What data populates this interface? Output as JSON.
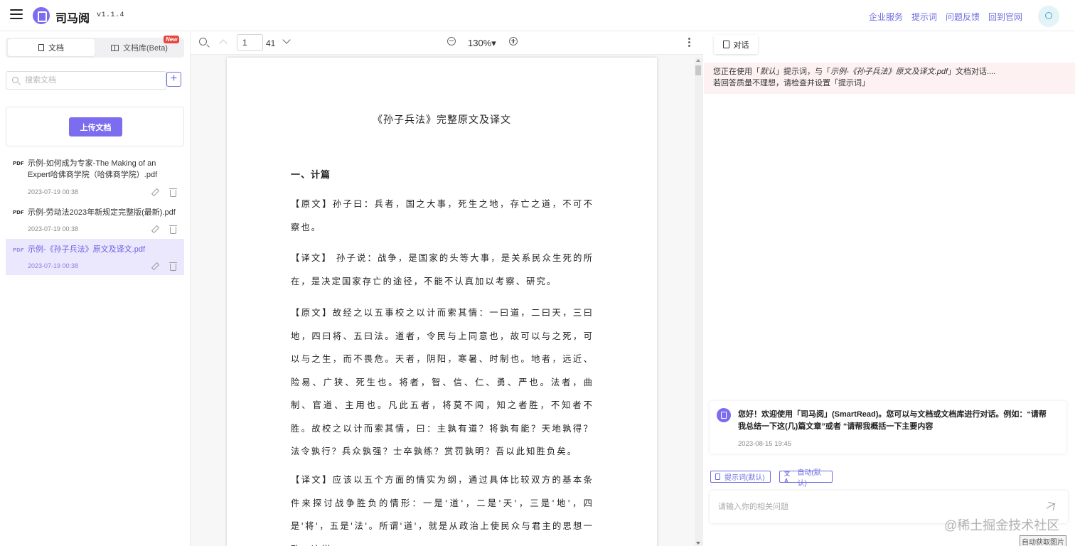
{
  "header": {
    "app_name": "司马阅",
    "version": "v1.1.4",
    "links": [
      "企业服务",
      "提示词",
      "问题反馈",
      "回到官网"
    ]
  },
  "sidebar": {
    "tabs": {
      "docs": "文档",
      "library": "文档库(Beta)",
      "new_badge": "New"
    },
    "search_placeholder": "搜索文档",
    "add_label": "+",
    "upload_label": "上传文档",
    "documents": [
      {
        "tag": "PDF",
        "title": "示例-如何成为专家-The Making of an Expert哈佛商学院（哈佛商学院）.pdf",
        "date": "2023-07-19 00:38"
      },
      {
        "tag": "PDF",
        "title": "示例-劳动法2023年新规定完整版(最新).pdf",
        "date": "2023-07-19 00:38"
      },
      {
        "tag": "PDF",
        "title": "示例-《孙子兵法》原文及译文.pdf",
        "date": "2023-07-19 00:38",
        "active": true
      }
    ]
  },
  "viewer": {
    "page_current": "1",
    "page_total": "41",
    "zoom": "130%▾",
    "doc_title": "《孙子兵法》完整原文及译文",
    "section": "一、计篇",
    "paragraphs": [
      "【原文】孙子曰：兵者，国之大事，死生之地，存亡之道，不可不察也。",
      "【译文】 孙子说：战争，是国家的头等大事，是关系民众生死的所在，是决定国家存亡的途径，不能不认真加以考察、研究。",
      "【原文】故经之以五事校之以计而索其情：一曰道，二曰天，三曰地，四曰将、五曰法。道者，令民与上同意也，故可以与之死，可以与之生，而不畏危。天者，阴阳，寒暑、时制也。地者，远近、险易、广狭、死生也。将者，智、信、仁、勇、严也。法者，曲制、官道、主用也。凡此五者，将莫不闻，知之者胜，不知者不胜。故校之以计而索其情，曰：主孰有道？将孰有能？天地孰得？法令孰行？兵众孰强？士卒孰练？赏罚孰明？吾以此知胜负矣。",
      "【译文】应该以五个方面的情实为纲，通过具体比较双方的基本条件来探讨战争胜负的情形：一是'道'，二是'天'，三是'地'，四是'将'，五是'法'。所谓'道'，就是从政治上使民众与君主的思想一致，这样，"
    ]
  },
  "chat": {
    "tab_label": "对话",
    "notice_prefix": "您正在使用「",
    "notice_prompt": "默认",
    "notice_mid": "」提示词，与「",
    "notice_doc": "示例-《孙子兵法》原文及译文.pdf",
    "notice_suffix": "」文档对话....",
    "notice_line2": "若回答质量不理想，请检查并设置「提示词」",
    "message": "您好！欢迎使用「司马阅」(SmartRead)。您可以与文档或文档库进行对话。例如：“请帮我总结一下这(几)篇文章”或者 “请帮我概括一下主要内容",
    "message_time": "2023-08-15 19:45",
    "pill_prompt": "提示词(默认)",
    "pill_auto": "自动(默认)",
    "input_placeholder": "请输入你的相关问题"
  },
  "overlay": {
    "watermark": "@稀土掘金技术社区",
    "label": "自动获取图片"
  },
  "colors": {
    "accent": "#7b6cf0",
    "link": "#6c6ce0",
    "notice_bg": "#fdf1f1",
    "active_item_bg": "#ebe8fd"
  }
}
